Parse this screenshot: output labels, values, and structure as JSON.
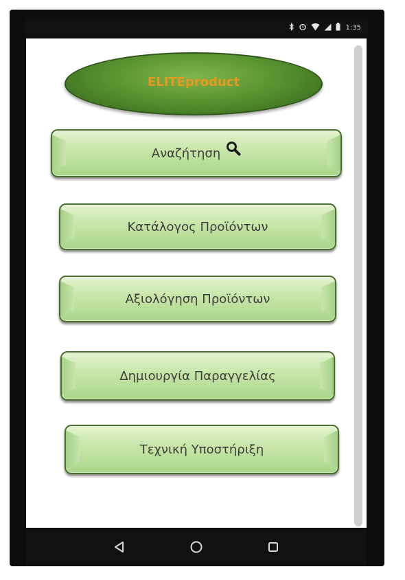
{
  "status_bar": {
    "time": "1:35",
    "icons": [
      "bluetooth-icon",
      "alarm-icon",
      "wifi-icon",
      "signal-icon",
      "battery-icon"
    ]
  },
  "app": {
    "title": "ELITEproduct",
    "title_color": "#e89a1f",
    "accent_green": "#5a9431"
  },
  "menu": {
    "items": [
      {
        "label": "Αναζήτηση",
        "icon": "search-icon"
      },
      {
        "label": "Κατάλογος Προϊόντων"
      },
      {
        "label": "Αξιολόγηση Προϊόντων"
      },
      {
        "label": "Δημιουργία Παραγγελίας"
      },
      {
        "label": "Τεχνική Υποστήριξη"
      }
    ]
  },
  "nav": {
    "icons": [
      "back-icon",
      "home-icon",
      "recents-icon"
    ]
  }
}
